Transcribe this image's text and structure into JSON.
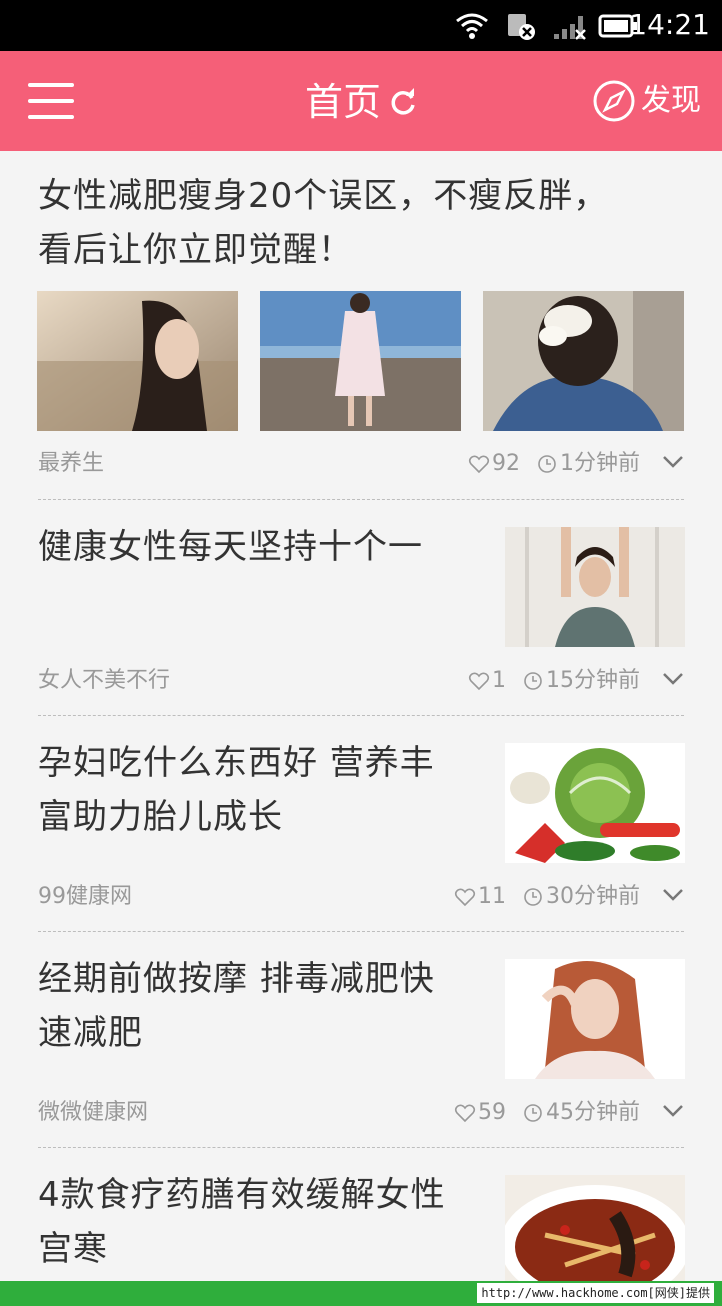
{
  "status_bar": {
    "time": "14:21"
  },
  "app_bar": {
    "title": "首页",
    "discover_label": "发现",
    "color": "#f55f78"
  },
  "articles": [
    {
      "title_line1": "女性减肥瘦身20个误区，不瘦反胖，",
      "title_line2": "看后让你立即觉醒！",
      "source": "最养生",
      "likes": "92",
      "time": "1分钟前"
    },
    {
      "title_line1": "健康女性每天坚持十个一",
      "title_line2": "",
      "source": "女人不美不行",
      "likes": "1",
      "time": "15分钟前"
    },
    {
      "title_line1": "孕妇吃什么东西好 营养丰",
      "title_line2": "富助力胎儿成长",
      "source": "99健康网",
      "likes": "11",
      "time": "30分钟前"
    },
    {
      "title_line1": "经期前做按摩 排毒减肥快",
      "title_line2": "速减肥",
      "source": "微微健康网",
      "likes": "59",
      "time": "45分钟前"
    },
    {
      "title_line1": "4款食疗药膳有效缓解女性",
      "title_line2": "宫寒"
    }
  ],
  "watermark": "http://www.hackhome.com[网侠]提供"
}
